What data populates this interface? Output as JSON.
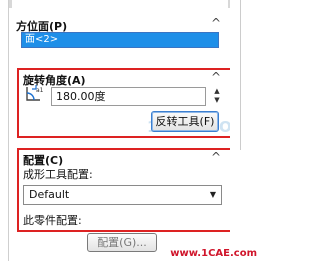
{
  "orientation_section": {
    "title": "方位面(P)",
    "selection_value": "面<2>"
  },
  "rotation_section": {
    "title": "旋转角度(A)",
    "angle_value": "180.00度",
    "reverse_button": "反转工具(F)"
  },
  "config_section": {
    "title": "配置(C)",
    "tool_config_label": "成形工具配置:",
    "tool_config_value": "Default",
    "part_config_label": "此零件配置:",
    "config_button": "配置(G)..."
  },
  "watermark": {
    "text": "www.1CAE.com",
    "ghost_text": "1CAE.COM"
  },
  "colors": {
    "highlight_frame": "#d22222",
    "selection_fill": "#1e8fe8",
    "watermark": "#d0152b"
  },
  "icons": {
    "collapse": "chevron-up-icon",
    "angle": "rotate-angle-icon",
    "dropdown": "chevron-down-icon",
    "spin": "spin-arrows-icon"
  }
}
